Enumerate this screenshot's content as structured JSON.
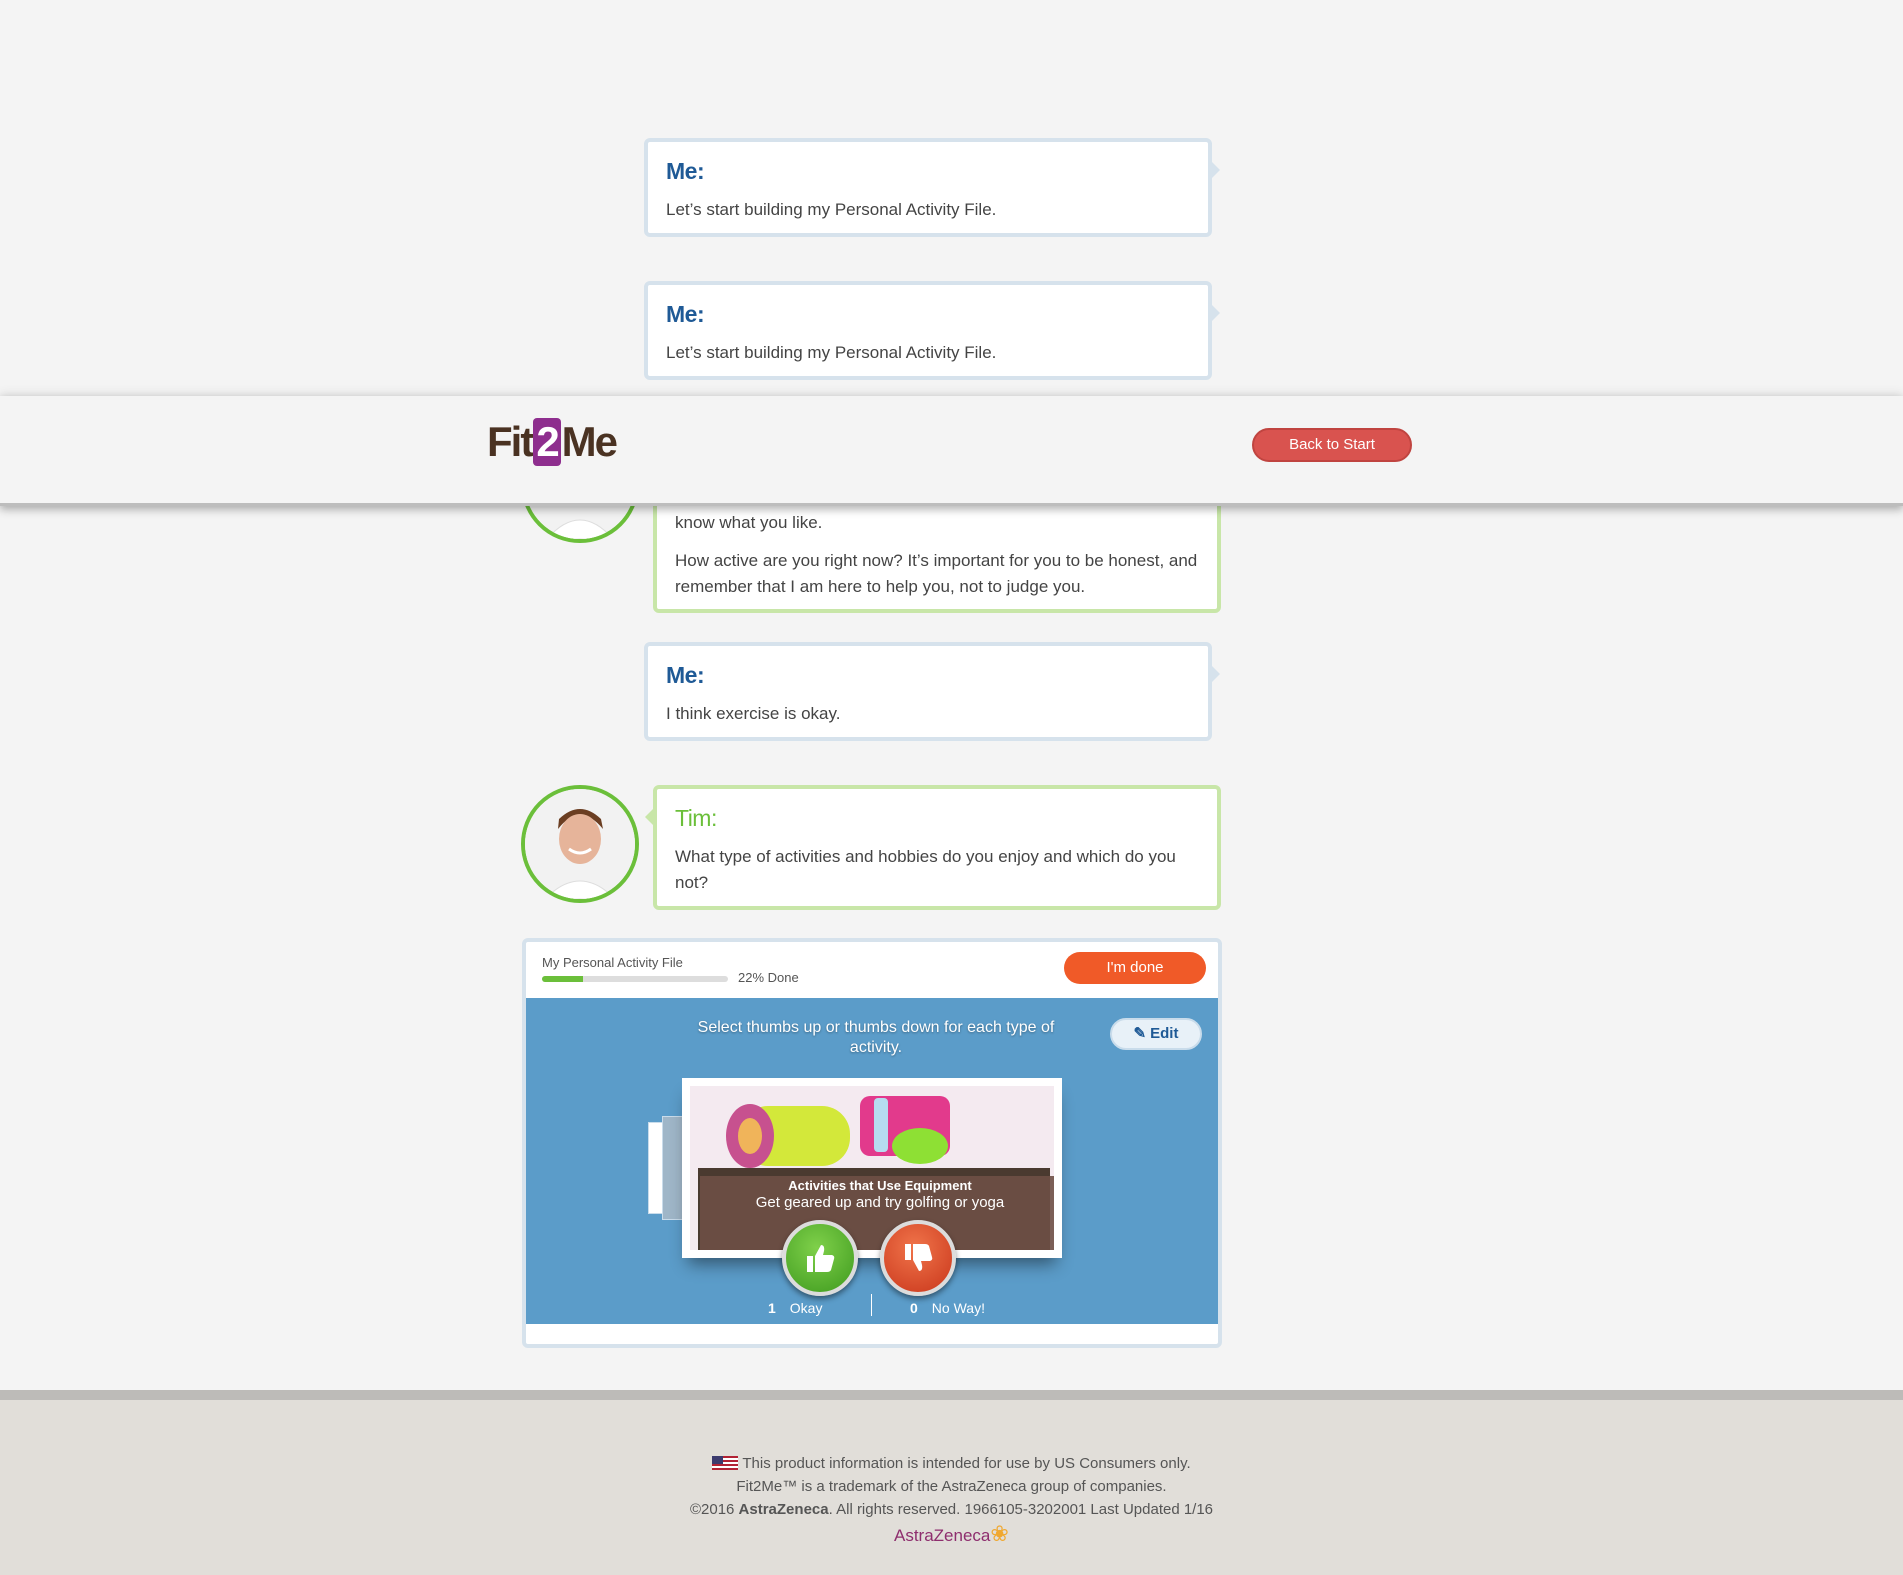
{
  "header": {
    "logo": {
      "part1": "Fit",
      "part2": "2",
      "part3": "Me"
    },
    "back_button": "Back to Start"
  },
  "conversation": {
    "me1": {
      "speaker": "Me:",
      "text": "Let’s start building my Personal Activity File."
    },
    "me2": {
      "speaker": "Me:",
      "text": "Let’s start building my Personal Activity File."
    },
    "tim1": {
      "line1": "know what you like.",
      "line2": "How active are you right now? It’s important for you to be honest, and remember that I am here to help you, not to judge you."
    },
    "me3": {
      "speaker": "Me:",
      "text": "I think exercise is okay."
    },
    "tim2": {
      "speaker": "Tim:",
      "text": "What type of activities and hobbies do you enjoy and which do you not?"
    }
  },
  "activity_file": {
    "title": "My Personal Activity File",
    "progress_percent": 22,
    "progress_label": "22% Done",
    "done_button": "I'm done",
    "instruction": "Select thumbs up or thumbs down for each type of activity.",
    "edit_button": "Edit",
    "card_title": "Activities that Use Equipment",
    "card_subtitle": "Get geared up and try golfing or yoga",
    "okay_count": "1",
    "okay_label": "Okay",
    "noway_count": "0",
    "noway_label": "No Way!"
  },
  "footer": {
    "line1": "This product information is intended for use by US Consumers only.",
    "line2": "Fit2Me™ is a trademark of the AstraZeneca group of companies.",
    "line3_prefix": "©2016 ",
    "line3_brand": "AstraZeneca",
    "line3_suffix": ". All rights reserved. 1966105-3202001 Last Updated 1/16",
    "logo_text": "AstraZeneca"
  },
  "colors": {
    "me_accent": "#1f5a96",
    "tim_accent": "#6bbf3a",
    "back_button": "#d9534f",
    "done_button": "#f05a28",
    "activity_bg": "#5b9cc9"
  }
}
